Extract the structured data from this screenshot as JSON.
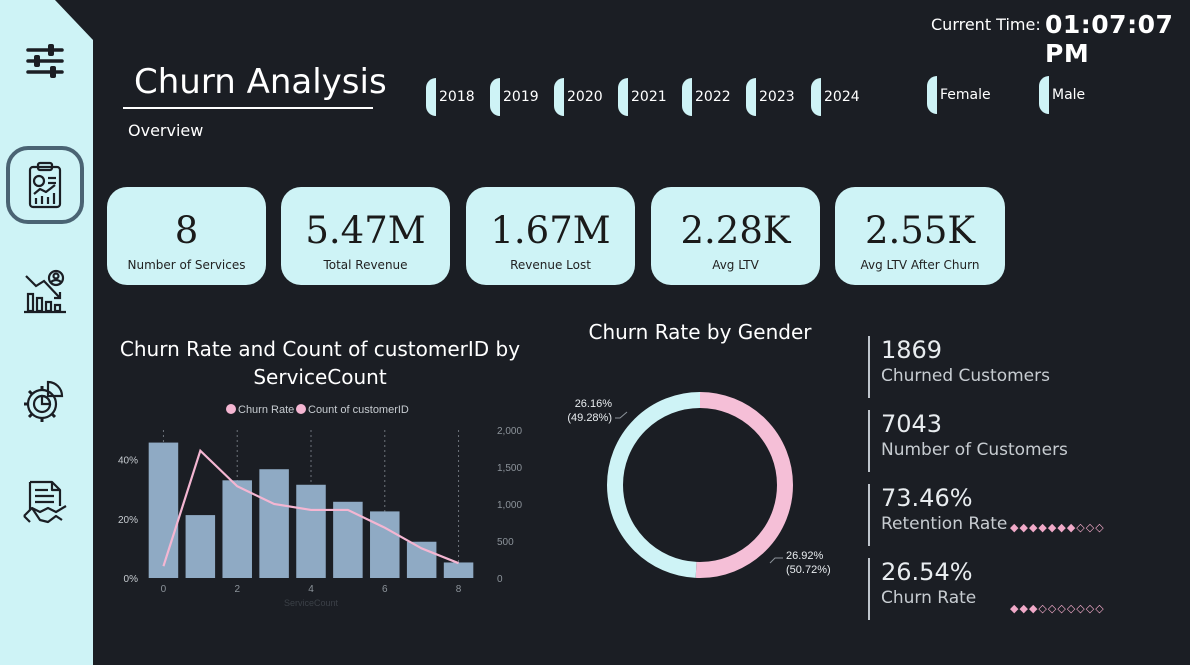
{
  "header": {
    "time_label": "Current Time:",
    "time_value": "01:07:07 PM",
    "title": "Churn Analysis",
    "subtitle": "Overview"
  },
  "sidebar": {
    "items": [
      {
        "name": "filters-icon"
      },
      {
        "name": "report-clipboard-icon",
        "active": true
      },
      {
        "name": "churn-decline-chart-icon"
      },
      {
        "name": "gear-analytics-icon"
      },
      {
        "name": "contract-handshake-icon"
      }
    ]
  },
  "filters": {
    "years": [
      "2018",
      "2019",
      "2020",
      "2021",
      "2022",
      "2023",
      "2024"
    ],
    "genders": [
      "Female",
      "Male"
    ]
  },
  "kpis": [
    {
      "value": "8",
      "label": "Number of Services"
    },
    {
      "value": "5.47M",
      "label": "Total Revenue"
    },
    {
      "value": "1.67M",
      "label": "Revenue Lost"
    },
    {
      "value": "2.28K",
      "label": "Avg LTV"
    },
    {
      "value": "2.55K",
      "label": "Avg LTV After Churn"
    }
  ],
  "stats": [
    {
      "value": "1869",
      "label": "Churned Customers"
    },
    {
      "value": "7043",
      "label": "Number of Customers"
    },
    {
      "value": "73.46%",
      "label": "Retention Rate",
      "rating_filled": 7,
      "rating_total": 10
    },
    {
      "value": "26.54%",
      "label": "Churn Rate",
      "rating_filled": 3,
      "rating_total": 10
    }
  ],
  "colors": {
    "accent_light": "#cef3f6",
    "bar": "#8faac4",
    "line": "#f4b6d2",
    "donut_female": "#cef3f6",
    "donut_male": "#f5bfd7"
  },
  "chart_data": [
    {
      "type": "bar",
      "title": "Churn Rate and Count of customerID by ServiceCount",
      "xlabel": "ServiceCount",
      "legend": [
        "Churn Rate",
        "Count of customerID"
      ],
      "legend_position": "top",
      "categories": [
        0,
        1,
        2,
        3,
        4,
        5,
        6,
        7,
        8
      ],
      "x_ticks": [
        "0",
        "2",
        "4",
        "6",
        "8"
      ],
      "series": [
        {
          "name": "Count of customerID",
          "kind": "bar",
          "axis": "right",
          "values": [
            1830,
            850,
            1320,
            1470,
            1260,
            1030,
            900,
            490,
            210
          ]
        },
        {
          "name": "Churn Rate",
          "kind": "line",
          "axis": "left",
          "values": [
            0.04,
            0.43,
            0.31,
            0.25,
            0.23,
            0.23,
            0.17,
            0.1,
            0.05
          ]
        }
      ],
      "y_left": {
        "ticks": [
          "0%",
          "20%",
          "40%"
        ],
        "range": [
          0,
          0.5
        ]
      },
      "y_right": {
        "ticks": [
          "0",
          "500",
          "1,000",
          "1,500",
          "2,000"
        ],
        "range": [
          0,
          2000
        ]
      }
    },
    {
      "type": "pie",
      "title": "Churn Rate by Gender",
      "slices": [
        {
          "name": "Male",
          "share": 0.5072,
          "label": "26.92%",
          "sublabel": "(50.72%)"
        },
        {
          "name": "Female",
          "share": 0.4928,
          "label": "26.16%",
          "sublabel": "(49.28%)"
        }
      ]
    }
  ]
}
